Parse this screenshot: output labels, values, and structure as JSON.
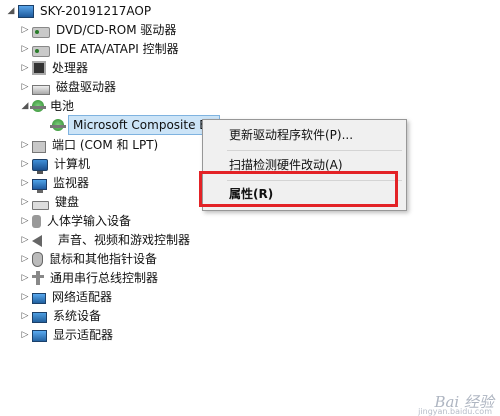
{
  "root": {
    "label": "SKY-20191217AOP",
    "icon": "computer-icon"
  },
  "items": [
    {
      "label": "DVD/CD-ROM 驱动器",
      "icon": "disc-drive-icon",
      "expanded": false
    },
    {
      "label": "IDE ATA/ATAPI 控制器",
      "icon": "ide-controller-icon",
      "expanded": false
    },
    {
      "label": "处理器",
      "icon": "processor-icon",
      "expanded": false
    },
    {
      "label": "磁盘驱动器",
      "icon": "disk-drive-icon",
      "expanded": false
    },
    {
      "label": "电池",
      "icon": "battery-icon",
      "expanded": true
    },
    {
      "label": "Microsoft Composite Ba",
      "icon": "battery-device-icon",
      "child": true,
      "selected": true
    },
    {
      "label": "端口 (COM 和 LPT)",
      "icon": "port-icon",
      "expanded": false
    },
    {
      "label": "计算机",
      "icon": "computer-category-icon",
      "expanded": false
    },
    {
      "label": "监视器",
      "icon": "monitor-icon",
      "expanded": false
    },
    {
      "label": "键盘",
      "icon": "keyboard-icon",
      "expanded": false
    },
    {
      "label": "人体学输入设备",
      "icon": "hid-icon",
      "expanded": false
    },
    {
      "label": "声音、视频和游戏控制器",
      "icon": "audio-icon",
      "expanded": false
    },
    {
      "label": "鼠标和其他指针设备",
      "icon": "mouse-icon",
      "expanded": false
    },
    {
      "label": "通用串行总线控制器",
      "icon": "usb-icon",
      "expanded": false
    },
    {
      "label": "网络适配器",
      "icon": "network-adapter-icon",
      "expanded": false
    },
    {
      "label": "系统设备",
      "icon": "system-device-icon",
      "expanded": false
    },
    {
      "label": "显示适配器",
      "icon": "display-adapter-icon",
      "expanded": false
    }
  ],
  "context_menu": {
    "update_driver": "更新驱动程序软件(P)...",
    "scan_hardware": "扫描检测硬件改动(A)",
    "properties": "属性(R)"
  },
  "highlight_color": "#e32226",
  "watermark": {
    "text": "Bai 经验",
    "sub": "jingyan.baidu.com"
  }
}
